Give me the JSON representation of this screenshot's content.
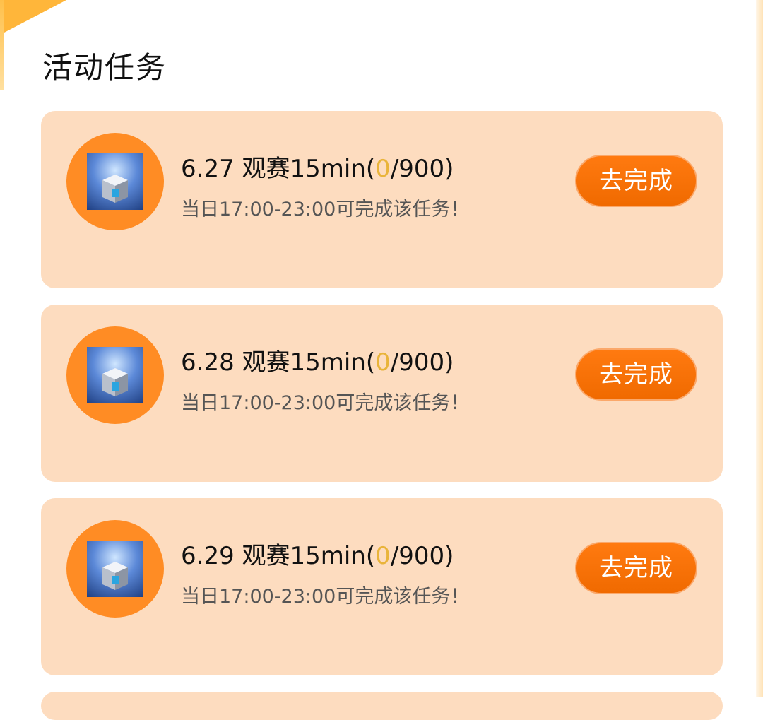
{
  "section": {
    "title": "活动任务"
  },
  "tasks": [
    {
      "date": "6.27",
      "name": "观赛15min",
      "paren_open": "(",
      "progress": "0",
      "total_suffix": "/900)",
      "subtitle": "当日17:00-23:00可完成该任务！",
      "button_label": "去完成"
    },
    {
      "date": "6.28",
      "name": "观赛15min",
      "paren_open": "(",
      "progress": "0",
      "total_suffix": "/900)",
      "subtitle": "当日17:00-23:00可完成该任务！",
      "button_label": "去完成"
    },
    {
      "date": "6.29",
      "name": "观赛15min",
      "paren_open": "(",
      "progress": "0",
      "total_suffix": "/900)",
      "subtitle": "当日17:00-23:00可完成该任务！",
      "button_label": "去完成"
    }
  ],
  "colors": {
    "card_bg": "#fddcbf",
    "icon_circle": "#ff8c24",
    "button": "#f57000",
    "progress_highlight": "#e9b43a"
  },
  "icons": {
    "task_icon": "treasure-chest-icon"
  }
}
